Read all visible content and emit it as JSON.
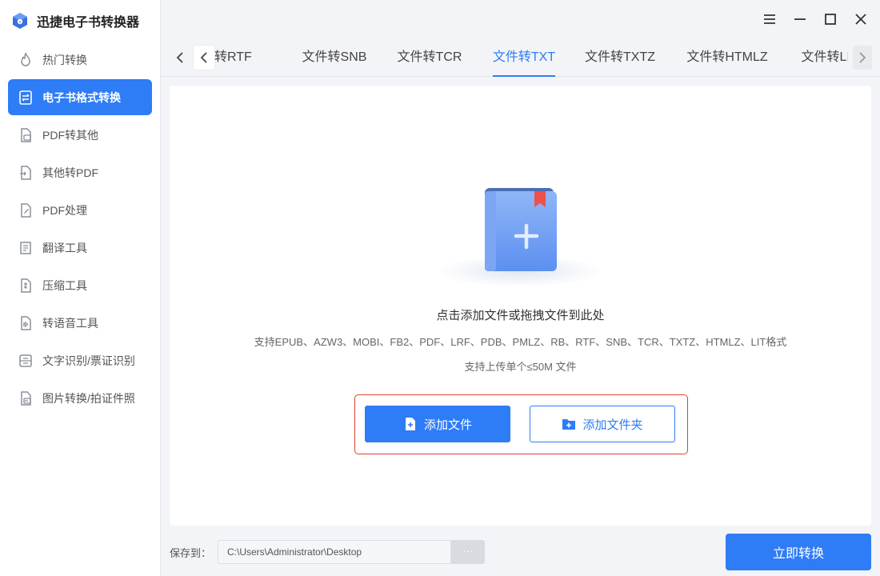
{
  "app": {
    "title": "迅捷电子书转换器"
  },
  "sidebar": {
    "items": [
      {
        "label": "热门转换",
        "icon": "flame-icon"
      },
      {
        "label": "电子书格式转换",
        "icon": "ebook-convert-icon",
        "active": true
      },
      {
        "label": "PDF转其他",
        "icon": "pdf-export-icon"
      },
      {
        "label": "其他转PDF",
        "icon": "pdf-import-icon"
      },
      {
        "label": "PDF处理",
        "icon": "pdf-edit-icon"
      },
      {
        "label": "翻译工具",
        "icon": "translate-icon"
      },
      {
        "label": "压缩工具",
        "icon": "compress-icon"
      },
      {
        "label": "转语音工具",
        "icon": "audio-icon"
      },
      {
        "label": "文字识别/票证识别",
        "icon": "ocr-icon"
      },
      {
        "label": "图片转换/拍证件照",
        "icon": "image-icon"
      }
    ]
  },
  "tabs": {
    "items": [
      {
        "label": "转RTF"
      },
      {
        "label": "文件转SNB"
      },
      {
        "label": "文件转TCR"
      },
      {
        "label": "文件转TXT",
        "active": true
      },
      {
        "label": "文件转TXTZ"
      },
      {
        "label": "文件转HTMLZ"
      },
      {
        "label": "文件转LIT"
      }
    ]
  },
  "dropzone": {
    "title": "点击添加文件或拖拽文件到此处",
    "formats": "支持EPUB、AZW3、MOBI、FB2、PDF、LRF、PDB、PMLZ、RB、RTF、SNB、TCR、TXTZ、HTMLZ、LIT格式",
    "limit": "支持上传单个≤50M 文件",
    "add_file": "添加文件",
    "add_folder": "添加文件夹"
  },
  "footer": {
    "save_label": "保存到：",
    "path": "C:\\Users\\Administrator\\Desktop",
    "browse": "···",
    "convert": "立即转换"
  },
  "colors": {
    "accent": "#2e7cf6",
    "highlight_border": "#e0412d",
    "background": "#f3f4f7"
  }
}
